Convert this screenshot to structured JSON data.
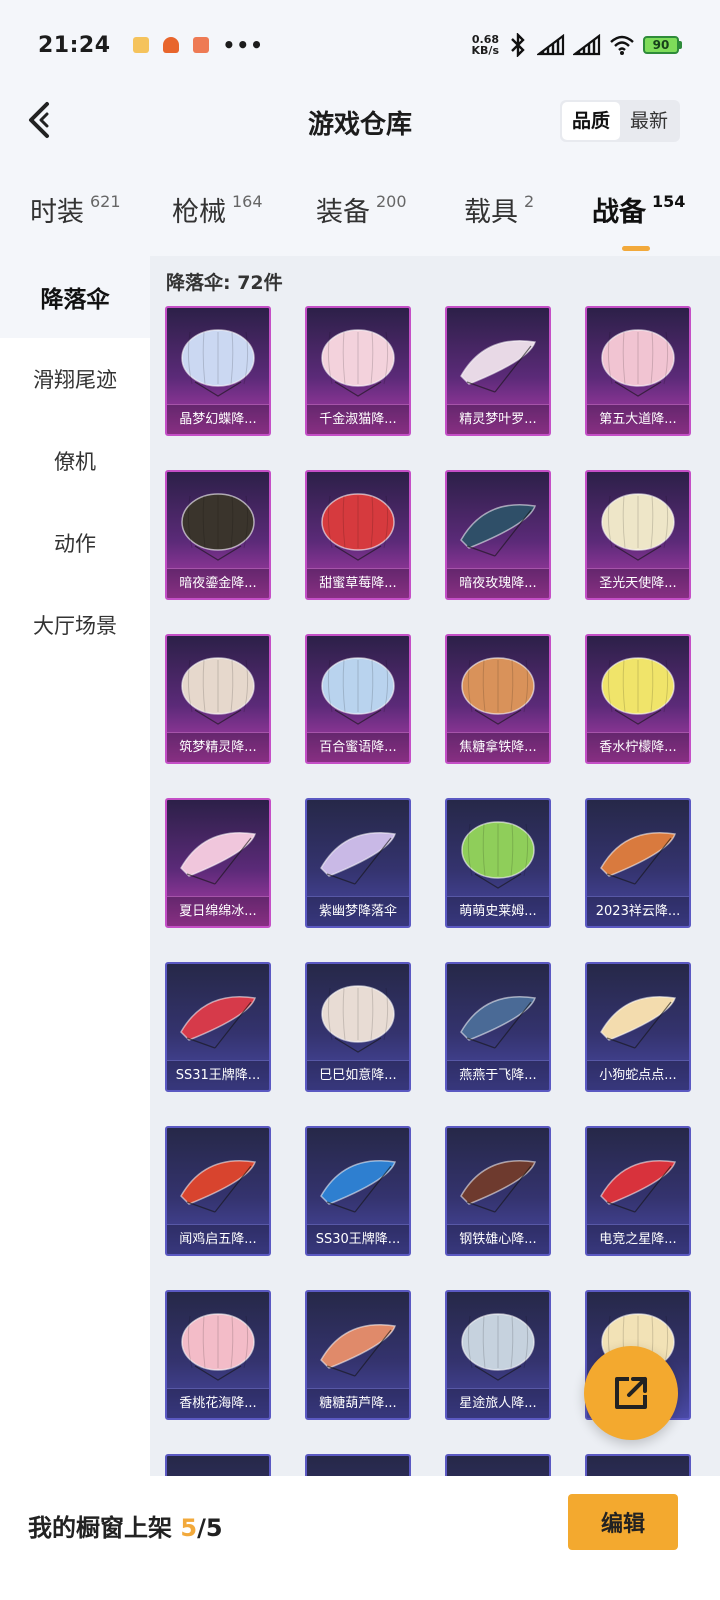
{
  "status_bar": {
    "time": "21:24",
    "dots": "•••",
    "speed_value": "0.68",
    "speed_unit": "KB/s",
    "battery": "90"
  },
  "header": {
    "title": "游戏仓库",
    "sort": [
      "品质",
      "最新"
    ]
  },
  "tabs": [
    {
      "label": "时装",
      "count": "621"
    },
    {
      "label": "枪械",
      "count": "164"
    },
    {
      "label": "装备",
      "count": "200"
    },
    {
      "label": "载具",
      "count": "2"
    },
    {
      "label": "战备",
      "count": "154"
    }
  ],
  "sidebar": {
    "items": [
      "降落伞",
      "滑翔尾迹",
      "僚机",
      "动作",
      "大厅场景"
    ]
  },
  "content": {
    "count_label": "降落伞: 72件"
  },
  "items": [
    {
      "name": "晶梦幻蝶降...",
      "rarity": "pink",
      "icon": "butterfly-parachute-icon",
      "color": "#cbd8f2"
    },
    {
      "name": "千金淑猫降...",
      "rarity": "pink",
      "icon": "cat-parachute-icon",
      "color": "#f3d2dc"
    },
    {
      "name": "精灵梦叶罗...",
      "rarity": "pink",
      "icon": "leaf-glider-icon",
      "color": "#e8d9e6"
    },
    {
      "name": "第五大道降...",
      "rarity": "pink",
      "icon": "plaid-parachute-icon",
      "color": "#f1c4d2"
    },
    {
      "name": "暗夜鎏金降...",
      "rarity": "pink",
      "icon": "dark-gold-parachute-icon",
      "color": "#3a342c"
    },
    {
      "name": "甜蜜草莓降...",
      "rarity": "pink",
      "icon": "strawberry-parachute-icon",
      "color": "#d63a3e"
    },
    {
      "name": "暗夜玫瑰降...",
      "rarity": "pink",
      "icon": "rose-glider-icon",
      "color": "#2f4f68"
    },
    {
      "name": "圣光天使降...",
      "rarity": "pink",
      "icon": "angel-parachute-icon",
      "color": "#eee6c8"
    },
    {
      "name": "筑梦精灵降...",
      "rarity": "pink",
      "icon": "dream-parachute-icon",
      "color": "#e6d8cc"
    },
    {
      "name": "百合蜜语降...",
      "rarity": "pink",
      "icon": "lily-parachute-icon",
      "color": "#b9d3ee"
    },
    {
      "name": "焦糖拿铁降...",
      "rarity": "pink",
      "icon": "latte-parachute-icon",
      "color": "#d9925a"
    },
    {
      "name": "香水柠檬降...",
      "rarity": "pink",
      "icon": "lemon-parachute-icon",
      "color": "#f0e46a"
    },
    {
      "name": "夏日绵绵冰...",
      "rarity": "pink",
      "icon": "icecream-glider-icon",
      "color": "#f0c6dc"
    },
    {
      "name": "紫幽梦降落伞",
      "rarity": "blue",
      "icon": "purple-dream-glider-icon",
      "color": "#c9b9e6"
    },
    {
      "name": "萌萌史莱姆...",
      "rarity": "blue",
      "icon": "slime-parachute-icon",
      "color": "#8fce5a"
    },
    {
      "name": "2023祥云降...",
      "rarity": "blue",
      "icon": "cloud-glider-icon",
      "color": "#d97a3e"
    },
    {
      "name": "SS31王牌降...",
      "rarity": "blue",
      "icon": "ace-glider-icon",
      "color": "#d63a4a"
    },
    {
      "name": "巳巳如意降...",
      "rarity": "blue",
      "icon": "snake-parachute-icon",
      "color": "#e8dcd4"
    },
    {
      "name": "燕燕于飞降...",
      "rarity": "blue",
      "icon": "swallow-glider-icon",
      "color": "#4a6a96"
    },
    {
      "name": "小狗蛇点点...",
      "rarity": "blue",
      "icon": "puppy-glider-icon",
      "color": "#f3dcae"
    },
    {
      "name": "闻鸡启五降...",
      "rarity": "blue",
      "icon": "rooster-glider-icon",
      "color": "#d8442e"
    },
    {
      "name": "SS30王牌降...",
      "rarity": "blue",
      "icon": "ss30-glider-icon",
      "color": "#2e7fd0"
    },
    {
      "name": "钢铁雄心降...",
      "rarity": "blue",
      "icon": "steel-glider-icon",
      "color": "#6e3a2e"
    },
    {
      "name": "电竞之星降...",
      "rarity": "blue",
      "icon": "esports-glider-icon",
      "color": "#d8323c"
    },
    {
      "name": "香桃花海降...",
      "rarity": "blue",
      "icon": "peach-parachute-icon",
      "color": "#f3bcc8"
    },
    {
      "name": "糖糖葫芦降...",
      "rarity": "blue",
      "icon": "candy-glider-icon",
      "color": "#e08a6a"
    },
    {
      "name": "星途旅人降...",
      "rarity": "blue",
      "icon": "traveler-parachute-icon",
      "color": "#c6d2de"
    },
    {
      "name": "",
      "rarity": "blue",
      "icon": "partial-parachute-icon",
      "color": "#f2e2b6"
    },
    {
      "name": "",
      "rarity": "blue",
      "icon": "",
      "color": ""
    },
    {
      "name": "",
      "rarity": "blue",
      "icon": "",
      "color": ""
    },
    {
      "name": "",
      "rarity": "blue",
      "icon": "",
      "color": ""
    },
    {
      "name": "",
      "rarity": "blue",
      "icon": "",
      "color": ""
    }
  ],
  "bottom_bar": {
    "label": "我的橱窗上架 ",
    "current": "5",
    "total": "/5",
    "edit": "编辑"
  }
}
